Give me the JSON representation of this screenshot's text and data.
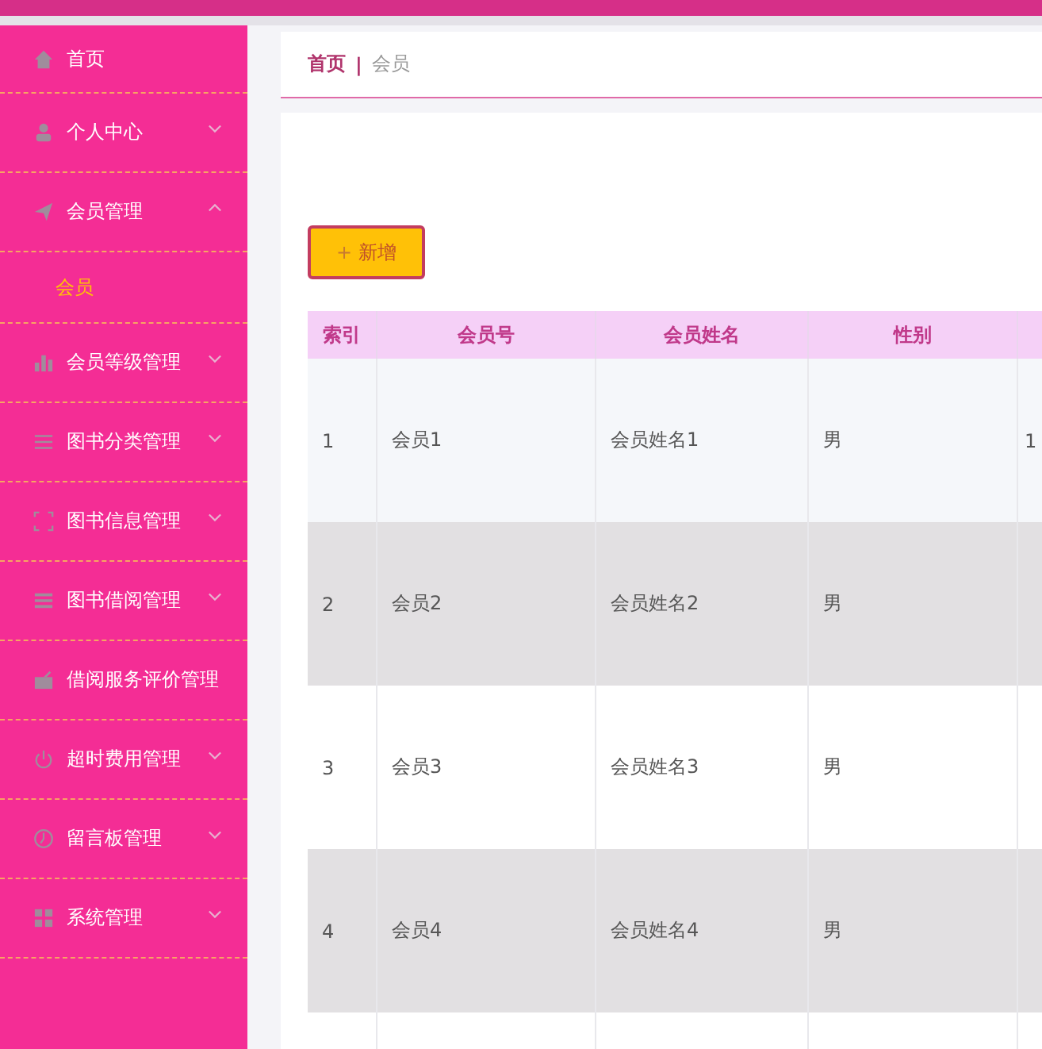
{
  "sidebar": {
    "items": [
      {
        "label": "首页",
        "kind": "link"
      },
      {
        "label": "个人中心",
        "kind": "menu",
        "expanded": false
      },
      {
        "label": "会员管理",
        "kind": "menu",
        "expanded": true,
        "children": [
          {
            "label": "会员",
            "selected": true
          }
        ]
      },
      {
        "label": "会员等级管理",
        "kind": "menu",
        "expanded": false
      },
      {
        "label": "图书分类管理",
        "kind": "menu",
        "expanded": false
      },
      {
        "label": "图书信息管理",
        "kind": "menu",
        "expanded": false
      },
      {
        "label": "图书借阅管理",
        "kind": "menu",
        "expanded": false
      },
      {
        "label": "借阅服务评价管理",
        "kind": "link"
      },
      {
        "label": "超时费用管理",
        "kind": "menu",
        "expanded": false
      },
      {
        "label": "留言板管理",
        "kind": "menu",
        "expanded": false
      },
      {
        "label": "系统管理",
        "kind": "menu",
        "expanded": false
      }
    ]
  },
  "breadcrumb": {
    "home": "首页",
    "separator": "|",
    "current": "会员"
  },
  "add_button": {
    "icon": "+",
    "label": "新增"
  },
  "table": {
    "columns": [
      "索引",
      "会员号",
      "会员姓名",
      "性别"
    ],
    "rows": [
      {
        "cells": [
          "1",
          "会员1",
          "会员姓名1",
          "男",
          "1"
        ]
      },
      {
        "cells": [
          "2",
          "会员2",
          "会员姓名2",
          "男"
        ]
      },
      {
        "cells": [
          "3",
          "会员3",
          "会员姓名3",
          "男"
        ]
      },
      {
        "cells": [
          "4",
          "会员4",
          "会员姓名4",
          "男"
        ]
      },
      {
        "cells": []
      }
    ]
  }
}
